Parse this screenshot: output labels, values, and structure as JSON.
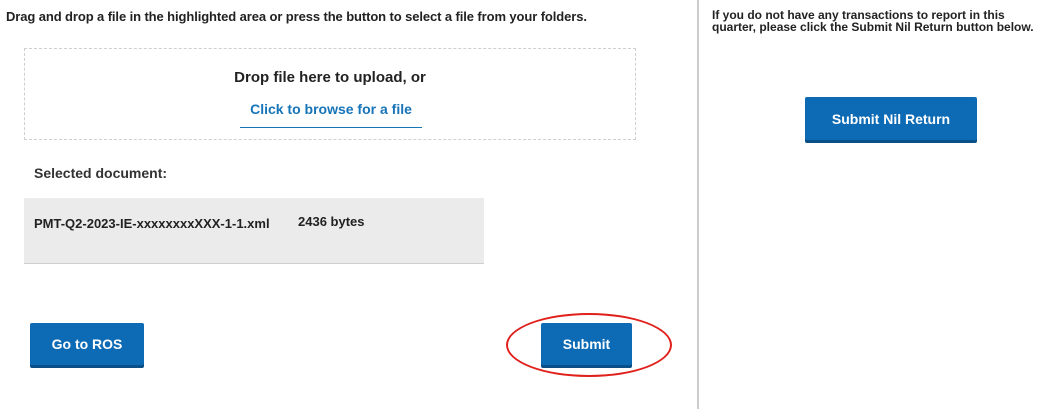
{
  "upload": {
    "instructions": "Drag and drop a file in the highlighted area or press the button to select a file from your folders.",
    "drop_text": "Drop file here to upload, or",
    "browse_link": "Click to browse for a file",
    "selected_label": "Selected document:",
    "file_name": "PMT-Q2-2023-IE-xxxxxxxxXXX-1-1.xml",
    "file_size": "2436 bytes"
  },
  "actions": {
    "go_to_ros": "Go to ROS",
    "submit": "Submit"
  },
  "nil_return": {
    "text": "If you do not have any transactions to report in this quarter, please click the Submit Nil Return button below.",
    "button": "Submit Nil Return"
  },
  "colors": {
    "button_bg": "#0d6bb5",
    "link": "#1674b8",
    "highlight": "#e0201b"
  }
}
